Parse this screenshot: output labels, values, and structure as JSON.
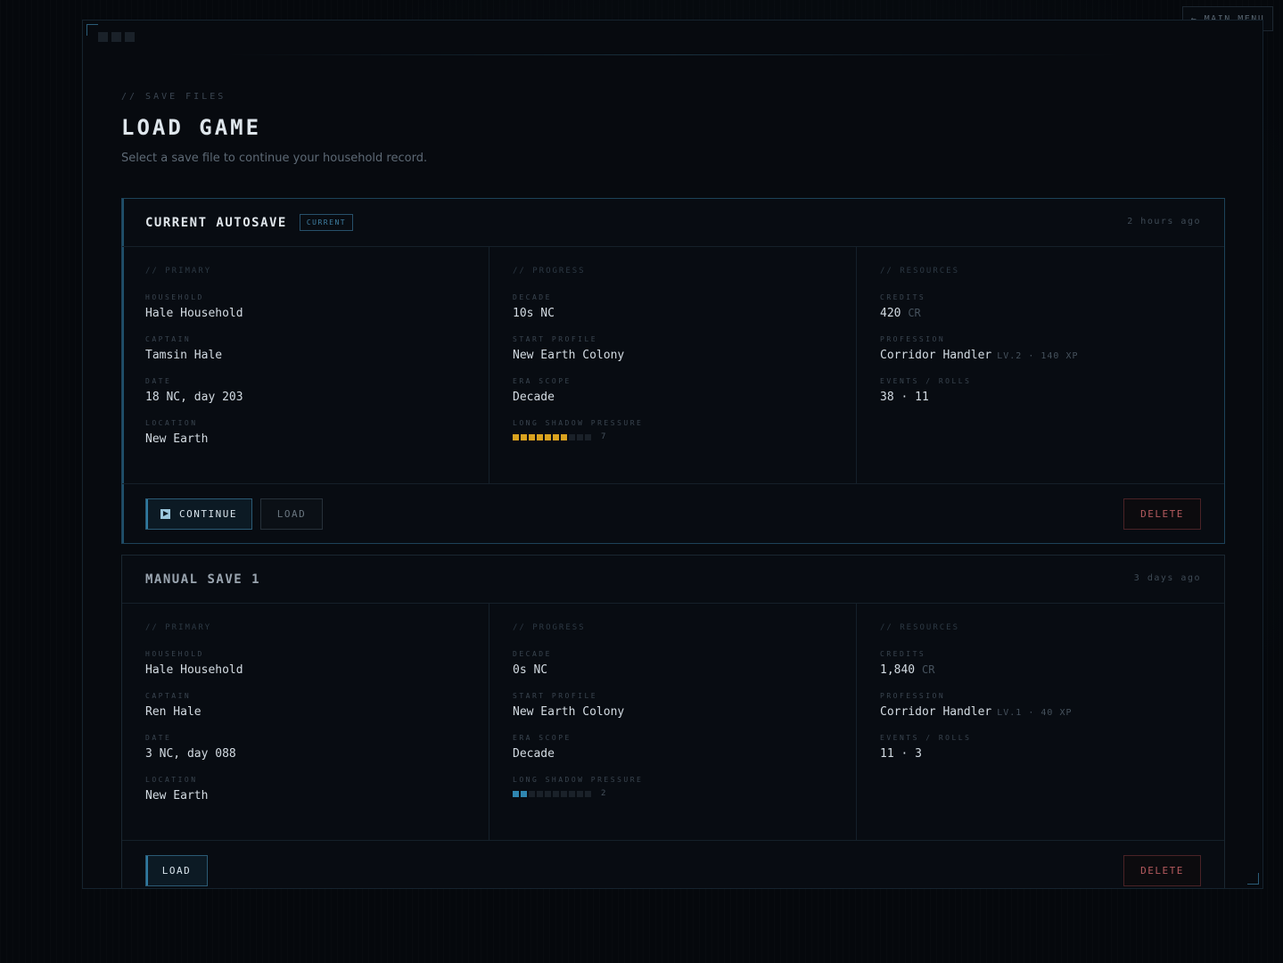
{
  "topbar": {
    "main_menu_label": "← MAIN MENU"
  },
  "header": {
    "eyebrow": "// SAVE FILES",
    "title": "LOAD GAME",
    "subtitle": "Select a save file to continue your household record."
  },
  "saves": [
    {
      "title": "CURRENT AUTOSAVE",
      "badge": "CURRENT",
      "time": "2 hours ago",
      "primary": {
        "heading": "// PRIMARY",
        "household_label": "HOUSEHOLD",
        "household": "Hale Household",
        "captain_label": "CAPTAIN",
        "captain": "Tamsin Hale",
        "date_label": "DATE",
        "date": "18 NC, day 203",
        "location_label": "LOCATION",
        "location": "New Earth"
      },
      "progress": {
        "heading": "// PROGRESS",
        "decade_label": "DECADE",
        "decade": "10s NC",
        "start_profile_label": "START PROFILE",
        "start_profile": "New Earth Colony",
        "era_scope_label": "ERA SCOPE",
        "era_scope": "Decade",
        "pressure_label": "LONG SHADOW PRESSURE",
        "pressure": "7",
        "pressure_value": 7,
        "pressure_max": 10,
        "pressure_color": "#d9a21f"
      },
      "resources": {
        "heading": "// RESOURCES",
        "credits_label": "CREDITS",
        "credits": "420",
        "credits_unit": "CR",
        "profession_label": "PROFESSION",
        "profession": "Corridor Handler",
        "profession_meta": "LV.2 · 140 XP",
        "events_label": "EVENTS / ROLLS",
        "events": "38 · 11"
      },
      "actions": {
        "continue": "CONTINUE",
        "load": "LOAD",
        "delete": "DELETE"
      }
    },
    {
      "title": "MANUAL SAVE 1",
      "time": "3 days ago",
      "primary": {
        "heading": "// PRIMARY",
        "household_label": "HOUSEHOLD",
        "household": "Hale Household",
        "captain_label": "CAPTAIN",
        "captain": "Ren Hale",
        "date_label": "DATE",
        "date": "3 NC, day 088",
        "location_label": "LOCATION",
        "location": "New Earth"
      },
      "progress": {
        "heading": "// PROGRESS",
        "decade_label": "DECADE",
        "decade": "0s NC",
        "start_profile_label": "START PROFILE",
        "start_profile": "New Earth Colony",
        "era_scope_label": "ERA SCOPE",
        "era_scope": "Decade",
        "pressure_label": "LONG SHADOW PRESSURE",
        "pressure": "2",
        "pressure_value": 2,
        "pressure_max": 10,
        "pressure_color": "#2f86b0"
      },
      "resources": {
        "heading": "// RESOURCES",
        "credits_label": "CREDITS",
        "credits": "1,840",
        "credits_unit": "CR",
        "profession_label": "PROFESSION",
        "profession": "Corridor Handler",
        "profession_meta": "LV.1 · 40 XP",
        "events_label": "EVENTS / ROLLS",
        "events": "11 · 3"
      },
      "actions": {
        "load": "LOAD",
        "delete": "DELETE"
      }
    }
  ]
}
